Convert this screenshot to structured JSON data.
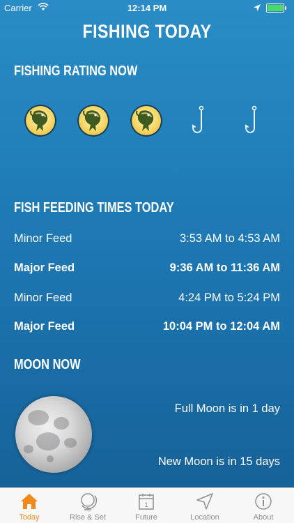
{
  "status_bar": {
    "carrier": "Carrier",
    "time": "12:14 PM"
  },
  "title": "FISHING TODAY",
  "rating": {
    "heading": "FISHING RATING NOW",
    "score": 3,
    "max": 5
  },
  "feeding": {
    "heading": "FISH FEEDING TIMES TODAY",
    "rows": [
      {
        "label": "Minor Feed",
        "time": "3:53 AM to 4:53 AM"
      },
      {
        "label": "Major Feed",
        "time": "9:36 AM to 11:36 AM"
      },
      {
        "label": "Minor Feed",
        "time": "4:24 PM to 5:24 PM"
      },
      {
        "label": "Major Feed",
        "time": "10:04 PM to 12:04 AM"
      }
    ]
  },
  "moon": {
    "heading": "MOON NOW",
    "full_moon": "Full Moon is in 1 day",
    "new_moon": "New Moon is in 15 days"
  },
  "tabs": [
    {
      "label": "Today",
      "icon": "house-icon"
    },
    {
      "label": "Rise & Set",
      "icon": "globe-icon"
    },
    {
      "label": "Future",
      "icon": "calendar-icon"
    },
    {
      "label": "Location",
      "icon": "location-arrow-icon"
    },
    {
      "label": "About",
      "icon": "info-icon"
    }
  ],
  "colors": {
    "accent": "#f08a1c",
    "bg_top": "#2a8cc6",
    "bg_bottom": "#155f95"
  }
}
